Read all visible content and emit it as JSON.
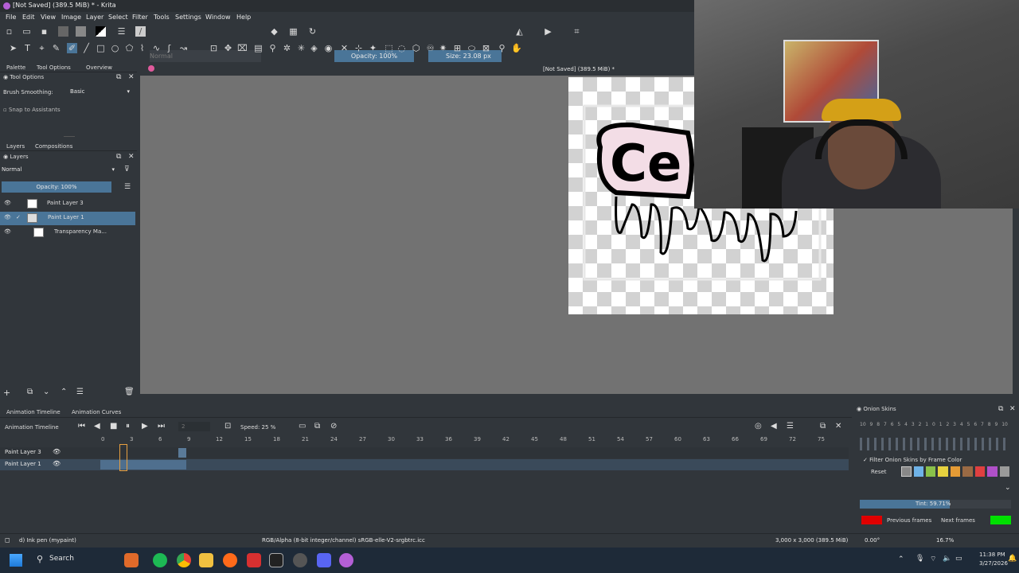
{
  "window": {
    "title": "[Not Saved]  (389.5 MiB) * - Krita"
  },
  "menu": [
    "File",
    "Edit",
    "View",
    "Image",
    "Layer",
    "Select",
    "Filter",
    "Tools",
    "Settings",
    "Window",
    "Help"
  ],
  "toolbar": {
    "blend_mode": "Normal",
    "opacity": "Opacity: 100%",
    "size": "Size: 23.08 px"
  },
  "docker_tabs": {
    "palette": "Palette",
    "tool_options": "Tool Options",
    "overview": "Overview"
  },
  "tool_options": {
    "title": "Tool Options",
    "brush_smoothing_label": "Brush Smoothing:",
    "brush_smoothing_value": "Basic",
    "snap": "Snap to Assistants"
  },
  "layers_tabs": {
    "layers": "Layers",
    "compositions": "Compositions"
  },
  "layers": {
    "title": "Layers",
    "blend": "Normal",
    "opacity": "Opacity:  100%",
    "items": [
      {
        "name": "Paint Layer 3"
      },
      {
        "name": "Paint Layer 1"
      },
      {
        "name": "Transparency Ma..."
      }
    ]
  },
  "canvas": {
    "header": "[Not Saved]  (389.5 MiB) *",
    "artwork_text": "Ce"
  },
  "timeline": {
    "tab1": "Animation Timeline",
    "tab2": "Animation Curves",
    "title": "Animation Timeline",
    "frame": "2",
    "speed": "Speed: 25 %",
    "ruler": [
      "0",
      "3",
      "6",
      "9",
      "12",
      "15",
      "18",
      "21",
      "24",
      "27",
      "30",
      "33",
      "36",
      "39",
      "42",
      "45",
      "48",
      "51",
      "54",
      "57",
      "60",
      "63",
      "66",
      "69",
      "72",
      "75"
    ],
    "layers": [
      "Paint Layer 3",
      "Paint Layer 1"
    ]
  },
  "onion": {
    "title": "Onion Skins",
    "scale": [
      "10",
      "9",
      "8",
      "7",
      "6",
      "5",
      "4",
      "3",
      "2",
      "1",
      "0",
      "1",
      "2",
      "3",
      "4",
      "5",
      "6",
      "7",
      "8",
      "9",
      "10"
    ],
    "filter": "Filter Onion Skins by Frame Color",
    "reset": "Reset",
    "tint": "Tint: 59.71%",
    "previous": "Previous frames",
    "next": "Next frames",
    "previous_color": "#e00000",
    "next_color": "#00e000"
  },
  "status": {
    "tool": "d) Ink pen (mypaint)",
    "color": "RGB/Alpha (8-bit integer/channel)  sRGB-elle-V2-srgbtrc.icc",
    "dims": "3,000 x 3,000 (389.5 MiB)",
    "rotation": "0.00°",
    "zoom": "16.7%"
  },
  "taskbar": {
    "search": "Search",
    "time": "11:38 PM",
    "date": "3/27/2026"
  }
}
